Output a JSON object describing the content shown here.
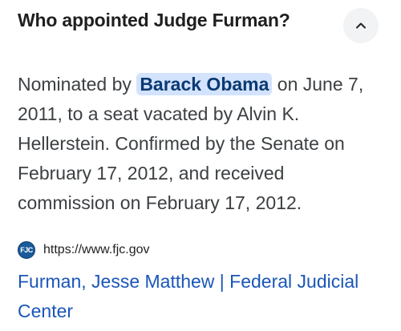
{
  "question": "Who appointed Judge Furman?",
  "collapse_icon": "chevron-up-icon",
  "answer": {
    "line1_prefix": "Nominated by ",
    "highlight": "Barack Obama",
    "line1_suffix": " on June 7,",
    "line2": "2011, to a seat vacated by Alvin K.",
    "line3": "Hellerstein. Confirmed by the Senate on",
    "line4": "February 17, 2012, and received",
    "line5": "commission on February 17, 2012."
  },
  "source": {
    "favicon_text": "FJC",
    "url": "https://www.fjc.gov",
    "title_line1": "Furman, Jesse Matthew | Federal Judicial",
    "title_line2": "Center"
  },
  "colors": {
    "link": "#1a56b8",
    "highlight_bg": "#d3e3fd",
    "button_bg": "#f1f3f4"
  }
}
